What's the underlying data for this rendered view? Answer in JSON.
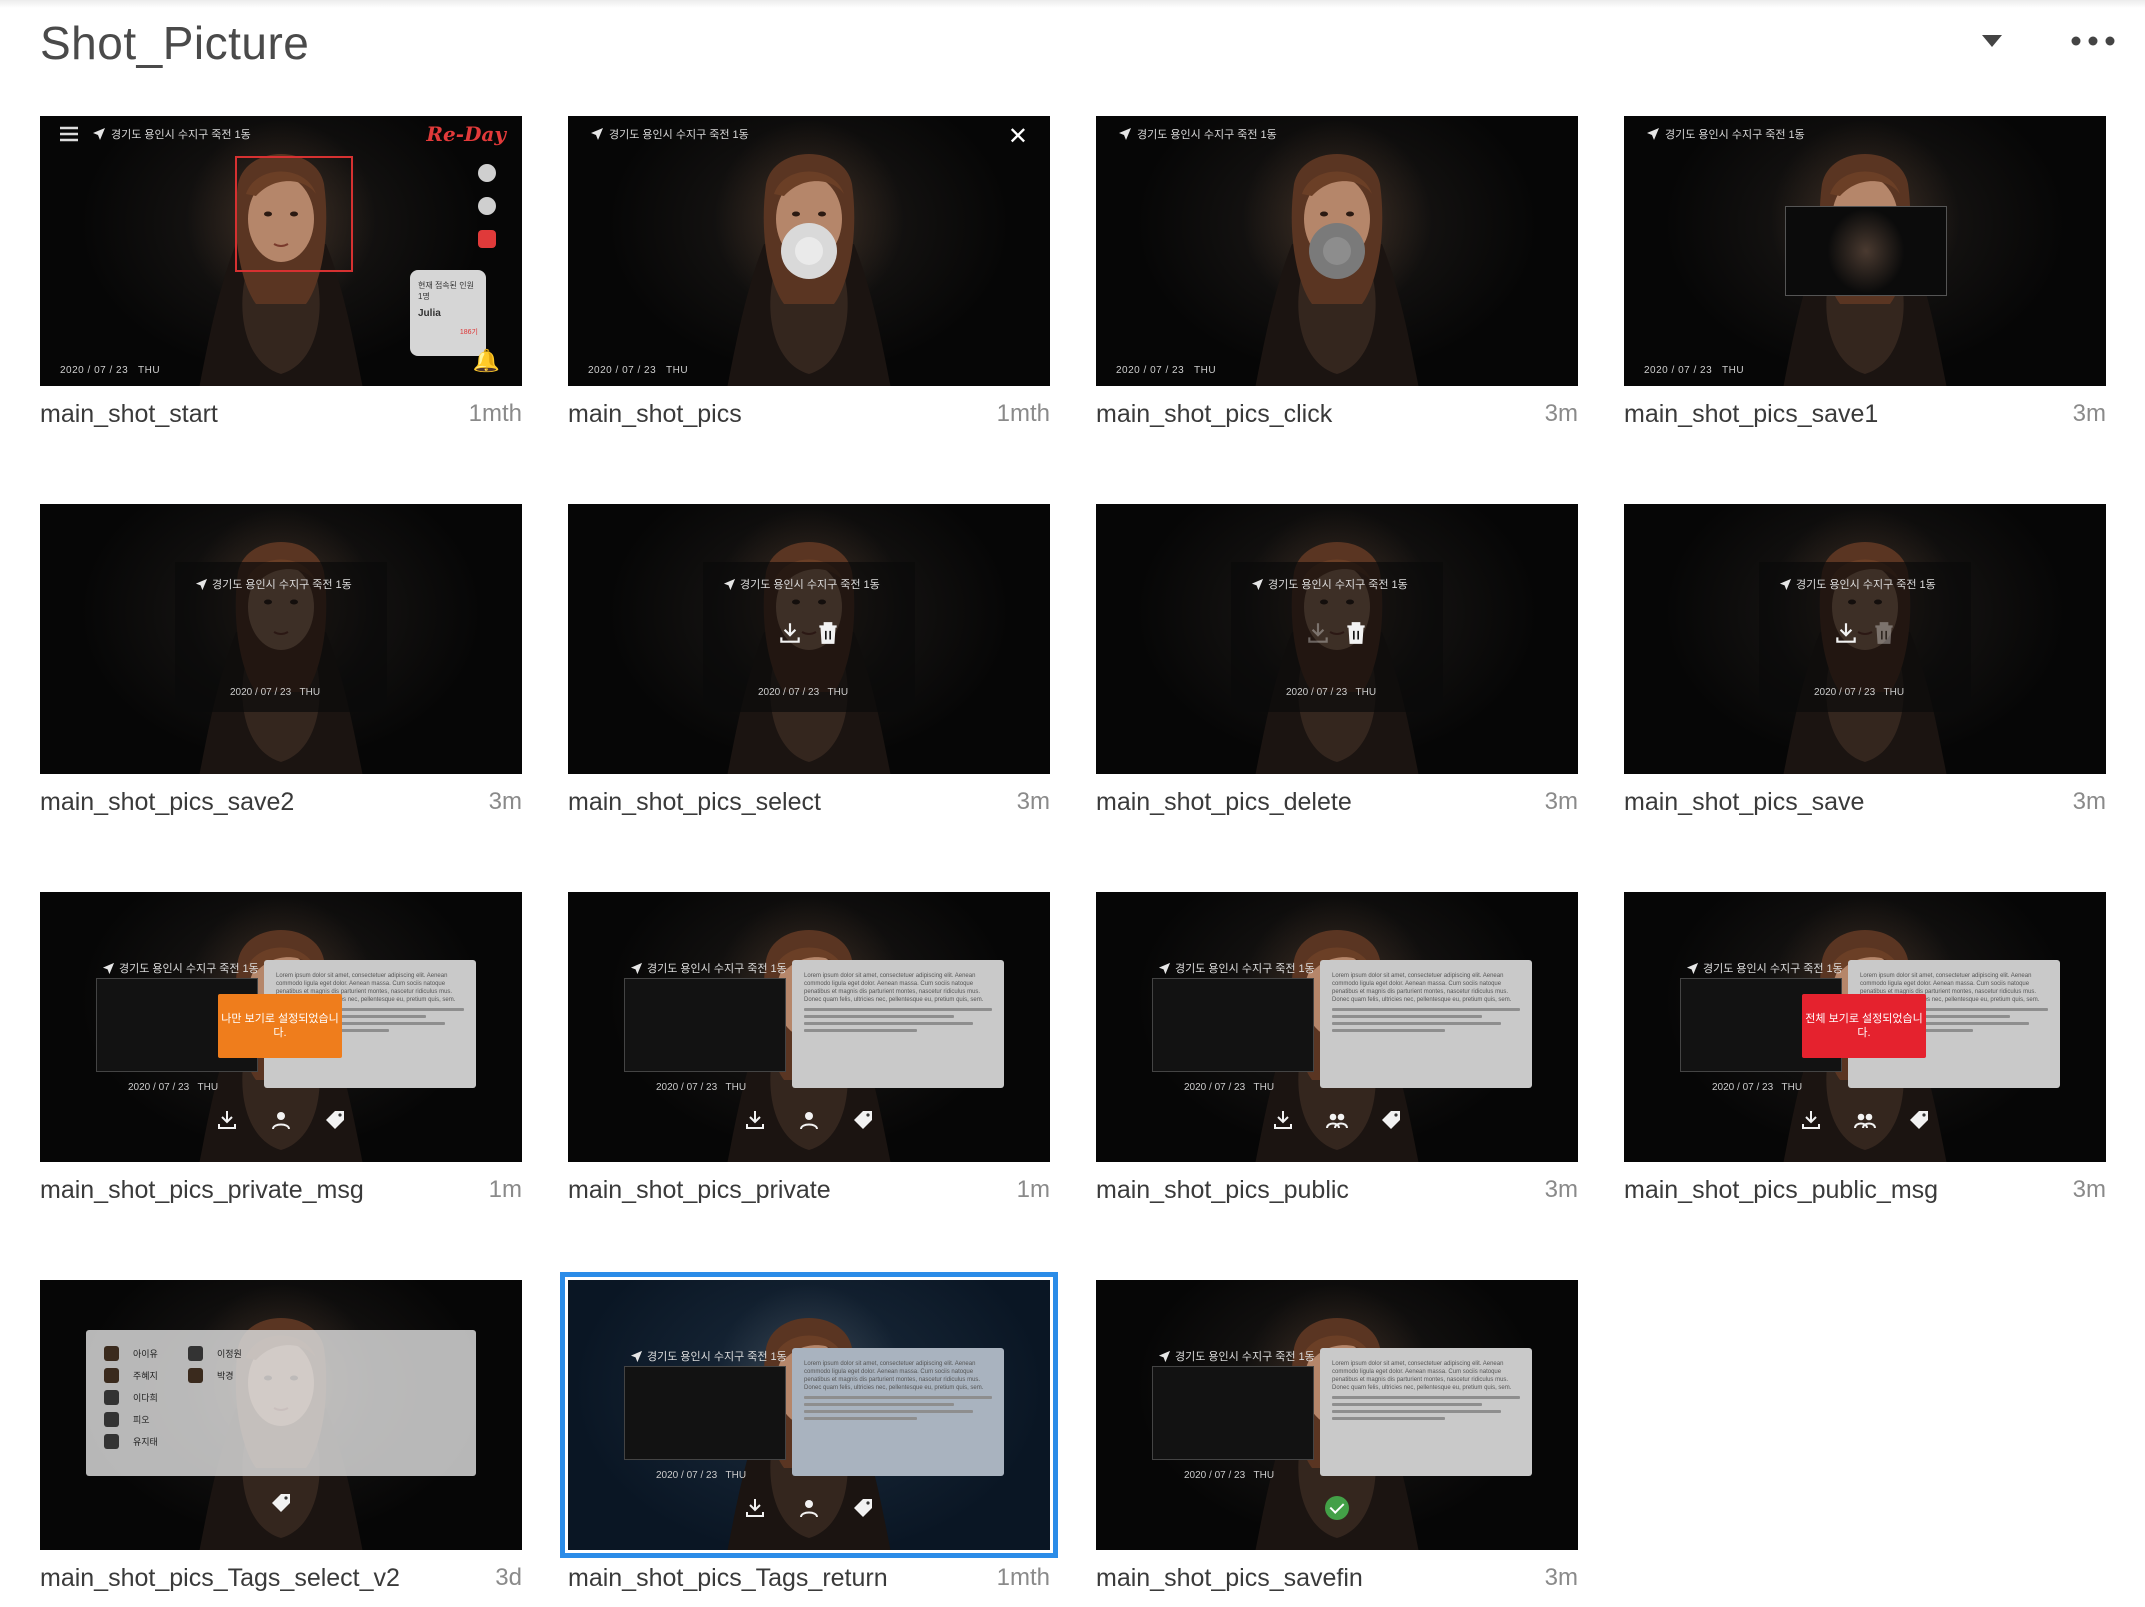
{
  "header": {
    "title": "Shot_Picture",
    "dropdown_icon": "caret-down-icon",
    "more_icon": "more-horizontal-icon"
  },
  "thumb_text": {
    "location": "경기도 용인시 수지구 죽전 1동",
    "date": "2020 / 07 / 23",
    "weekday": "THU",
    "brand": "Re-Day",
    "card_caption": "현재 접속된 인원 1명",
    "card_name": "Julia",
    "card_count": "186기",
    "private_msg": "나만 보기로 설정되었습니다.",
    "public_msg": "전체 보기로 설정되었습니다.",
    "detail_text": "Lorem ipsum dolor sit amet, consectetuer adipiscing elit. Aenean commodo ligula eget dolor. Aenean massa. Cum sociis natoque penatibus et magnis dis parturient montes, nascetur ridiculus mus. Donec quam felis, ultricies nec, pellentesque eu, pretium quis, sem.",
    "tag_people_left": [
      "아이유",
      "주혜지",
      "이다희",
      "피오",
      "유지태"
    ],
    "tag_people_right": [
      "이정원",
      "박경"
    ]
  },
  "accent_color": "#2b8ce8",
  "items": [
    {
      "name": "main_shot_start",
      "age": "1mth"
    },
    {
      "name": "main_shot_pics",
      "age": "1mth"
    },
    {
      "name": "main_shot_pics_click",
      "age": "3m"
    },
    {
      "name": "main_shot_pics_save1",
      "age": "3m"
    },
    {
      "name": "main_shot_pics_save2",
      "age": "3m"
    },
    {
      "name": "main_shot_pics_select",
      "age": "3m"
    },
    {
      "name": "main_shot_pics_delete",
      "age": "3m"
    },
    {
      "name": "main_shot_pics_save",
      "age": "3m"
    },
    {
      "name": "main_shot_pics_private_msg",
      "age": "1m"
    },
    {
      "name": "main_shot_pics_private",
      "age": "1m"
    },
    {
      "name": "main_shot_pics_public",
      "age": "3m"
    },
    {
      "name": "main_shot_pics_public_msg",
      "age": "3m"
    },
    {
      "name": "main_shot_pics_Tags_select_v2",
      "age": "3d"
    },
    {
      "name": "main_shot_pics_Tags_return",
      "age": "1mth",
      "selected": true
    },
    {
      "name": "main_shot_pics_savefin",
      "age": "3m"
    }
  ]
}
